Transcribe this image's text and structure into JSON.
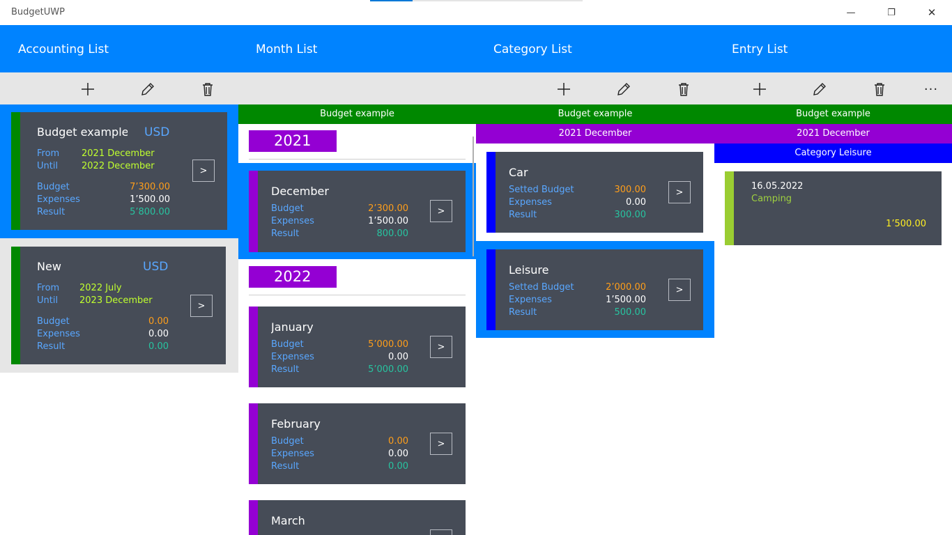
{
  "app": {
    "title": "BudgetUWP"
  },
  "window_controls": {
    "minimize": "—",
    "restore": "❐",
    "close": "✕"
  },
  "columns": {
    "accounting": "Accounting List",
    "month": "Month List",
    "category": "Category List",
    "entry": "Entry List"
  },
  "toolbar": {
    "add": "add",
    "edit": "edit",
    "delete": "delete",
    "more": "···"
  },
  "month_context": "Budget example",
  "category_context": {
    "budget": "Budget example",
    "month": "2021 December"
  },
  "entry_context": {
    "budget": "Budget example",
    "month": "2021 December",
    "category": "Category Leisure"
  },
  "accounts": [
    {
      "name": "Budget example",
      "currency": "USD",
      "from_label": "From",
      "from_value": "2021 December",
      "until_label": "Until",
      "until_value": "2022 December",
      "budget_label": "Budget",
      "budget_value": "7’300.00",
      "expenses_label": "Expenses",
      "expenses_value": "1’500.00",
      "result_label": "Result",
      "result_value": "5’800.00",
      "open": ">"
    },
    {
      "name": "New",
      "currency": "USD",
      "from_label": "From",
      "from_value": "2022 July",
      "until_label": "Until",
      "until_value": "2023 December",
      "budget_label": "Budget",
      "budget_value": "0.00",
      "expenses_label": "Expenses",
      "expenses_value": "0.00",
      "result_label": "Result",
      "result_value": "0.00",
      "open": ">"
    }
  ],
  "years": [
    "2021",
    "2022"
  ],
  "months": [
    {
      "name": "December",
      "budget_label": "Budget",
      "budget": "2’300.00",
      "expenses_label": "Expenses",
      "expenses": "1’500.00",
      "result_label": "Result",
      "result": "800.00",
      "open": ">"
    },
    {
      "name": "January",
      "budget_label": "Budget",
      "budget": "5’000.00",
      "expenses_label": "Expenses",
      "expenses": "0.00",
      "result_label": "Result",
      "result": "5’000.00",
      "open": ">"
    },
    {
      "name": "February",
      "budget_label": "Budget",
      "budget": "0.00",
      "expenses_label": "Expenses",
      "expenses": "0.00",
      "result_label": "Result",
      "result": "0.00",
      "open": ">"
    },
    {
      "name": "March"
    }
  ],
  "categories": [
    {
      "name": "Car",
      "budget_label": "Setted Budget",
      "budget": "300.00",
      "expenses_label": "Expenses",
      "expenses": "0.00",
      "result_label": "Result",
      "result": "300.00",
      "open": ">"
    },
    {
      "name": "Leisure",
      "budget_label": "Setted Budget",
      "budget": "2’000.00",
      "expenses_label": "Expenses",
      "expenses": "1’500.00",
      "result_label": "Result",
      "result": "500.00",
      "open": ">"
    }
  ],
  "entries": [
    {
      "date": "16.05.2022",
      "description": "Camping",
      "amount": "1’500.00"
    }
  ],
  "colors": {
    "header_blue": "#0083ff",
    "account_stripe": "#008800",
    "month_stripe": "#9400d3",
    "category_stripe": "#0000ff",
    "entry_stripe": "#9acd32",
    "card_bg": "#464c57"
  }
}
